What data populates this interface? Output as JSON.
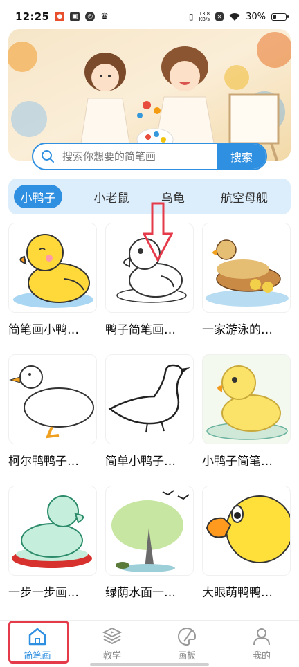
{
  "status_bar": {
    "time": "12:25",
    "net_speed_value": "13.8",
    "net_speed_unit": "KB/s",
    "battery": "30%"
  },
  "search": {
    "placeholder": "搜索你想要的简笔画",
    "button_label": "搜索"
  },
  "tabs": [
    {
      "label": "小鸭子",
      "active": true
    },
    {
      "label": "小老鼠",
      "active": false
    },
    {
      "label": "乌龟",
      "active": false
    },
    {
      "label": "航空母舰",
      "active": false
    }
  ],
  "cards": [
    {
      "title": "简笔画小鸭…"
    },
    {
      "title": "鸭子简笔画…"
    },
    {
      "title": "一家游泳的…"
    },
    {
      "title": "柯尔鸭鸭子…"
    },
    {
      "title": "简单小鸭子…"
    },
    {
      "title": "小鸭子简笔…"
    },
    {
      "title": "一步一步画…"
    },
    {
      "title": "绿荫水面一…"
    },
    {
      "title": "大眼萌鸭鸭…"
    }
  ],
  "bottom_nav": [
    {
      "label": "简笔画",
      "icon": "home-icon",
      "active": true
    },
    {
      "label": "教学",
      "icon": "play-stack-icon",
      "active": false
    },
    {
      "label": "画板",
      "icon": "palette-icon",
      "active": false
    },
    {
      "label": "我的",
      "icon": "user-icon",
      "active": false
    }
  ],
  "colors": {
    "accent": "#2f8fe0",
    "tab_bar_bg": "#dcedfb",
    "highlight": "#e53a4a"
  }
}
